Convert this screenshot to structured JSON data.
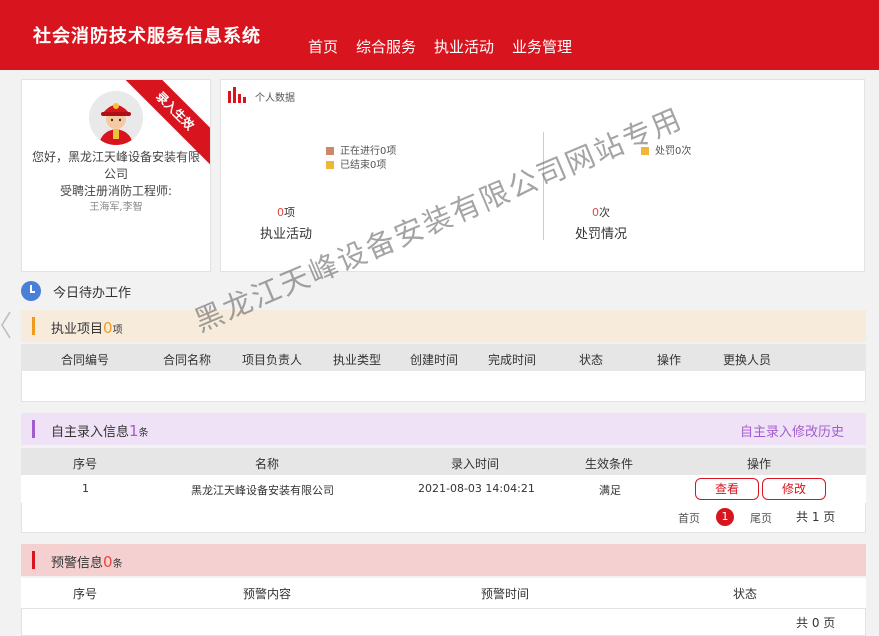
{
  "header": {
    "system_title": "社会消防技术服务信息系统",
    "nav": [
      "首页",
      "综合服务",
      "执业活动",
      "业务管理"
    ],
    "brand_color": "#d8141e"
  },
  "profile": {
    "ribbon": "录入生效",
    "greeting": "您好，黑龙江天峰设备安装有限公司",
    "role": "受聘注册消防工程师:",
    "engineers": "王海军,李智"
  },
  "personal_data": {
    "title": "个人数据",
    "practice": {
      "legend": [
        {
          "label": "正在进行0项",
          "color": "#c98a6a"
        },
        {
          "label": "已结束0项",
          "color": "#f0b63a"
        }
      ],
      "count": "0",
      "count_unit": "项",
      "label": "执业活动"
    },
    "penalty": {
      "legend": [
        {
          "label": "处罚0次",
          "color": "#f0b63a"
        }
      ],
      "count": "0",
      "count_unit": "次",
      "label": "处罚情况"
    }
  },
  "today": {
    "title": "今日待办工作"
  },
  "practice_projects": {
    "title": "执业项目",
    "count": "0",
    "unit": "项",
    "columns": [
      "合同编号",
      "合同名称",
      "项目负责人",
      "执业类型",
      "创建时间",
      "完成时间",
      "状态",
      "操作",
      "更换人员"
    ]
  },
  "self_entry": {
    "title": "自主录入信息",
    "count": "1",
    "unit": "条",
    "history_link": "自主录入修改历史",
    "columns": [
      "序号",
      "名称",
      "录入时间",
      "生效条件",
      "操作"
    ],
    "rows": [
      {
        "no": "1",
        "name": "黑龙江天峰设备安装有限公司",
        "time": "2021-08-03 14:04:21",
        "condition": "满足",
        "actions": [
          "查看",
          "修改"
        ]
      }
    ],
    "pager": {
      "first": "首页",
      "current": "1",
      "last": "尾页",
      "total": "共 1 页"
    }
  },
  "warnings": {
    "title": "预警信息",
    "count": "0",
    "unit": "条",
    "columns": [
      "序号",
      "预警内容",
      "预警时间",
      "状态"
    ],
    "pager": {
      "total": "共 0 页"
    }
  },
  "watermark": "黑龙江天峰设备安装有限公司网站专用"
}
